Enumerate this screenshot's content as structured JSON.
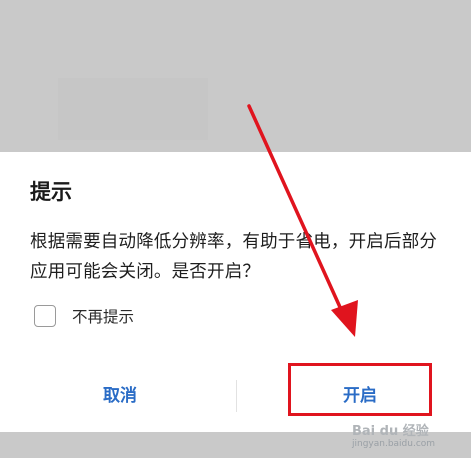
{
  "dialog": {
    "title": "提示",
    "message": "根据需要自动降低分辨率，有助于省电，开启后部分应用可能会关闭。是否开启？",
    "checkbox_label": "不再提示",
    "checkbox_checked": false,
    "cancel_label": "取消",
    "confirm_label": "开启"
  },
  "annotation": {
    "arrow_color": "#e0141e",
    "box_color": "#e0141e"
  },
  "watermark": {
    "logo": "Bai du 经验",
    "url": "jingyan.baidu.com"
  },
  "colors": {
    "accent": "#2a6cc6",
    "scrim": "#c9c9c9"
  }
}
